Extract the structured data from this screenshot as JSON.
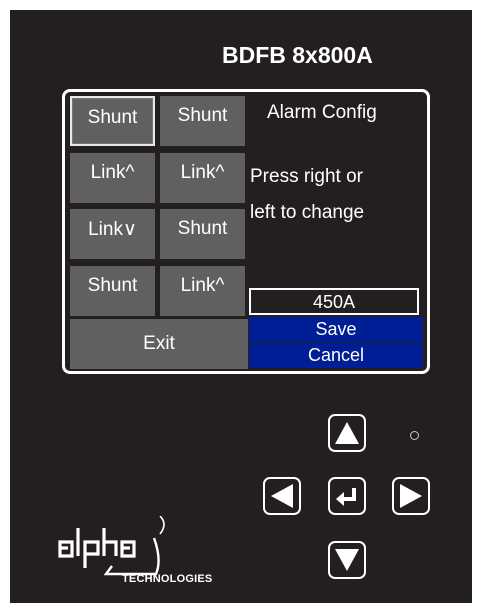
{
  "header": {
    "model": "BDFB 8x800A"
  },
  "screen": {
    "grid": [
      {
        "label": "Shunt",
        "selected": true
      },
      {
        "label": "Shunt",
        "selected": false
      },
      {
        "label": "Link^",
        "selected": false
      },
      {
        "label": "Link^",
        "selected": false
      },
      {
        "label": "Link∨",
        "selected": false
      },
      {
        "label": "Shunt",
        "selected": false
      },
      {
        "label": "Shunt",
        "selected": false
      },
      {
        "label": "Link^",
        "selected": false
      }
    ],
    "exit_label": "Exit",
    "title": "Alarm Config",
    "instruction_line1": "Press right or",
    "instruction_line2": "left to change",
    "value": "450A",
    "save_label": "Save",
    "cancel_label": "Cancel"
  },
  "keypad": {
    "up": "arrow-up-icon",
    "left": "arrow-left-icon",
    "enter": "enter-icon",
    "right": "arrow-right-icon",
    "down": "arrow-down-icon"
  },
  "logo": {
    "brand": "alpha",
    "subtext": "TECHNOLOGIES"
  },
  "colors": {
    "panel": "#231f20",
    "cell": "#606060",
    "highlight": "#001e96",
    "text": "#ffffff"
  }
}
